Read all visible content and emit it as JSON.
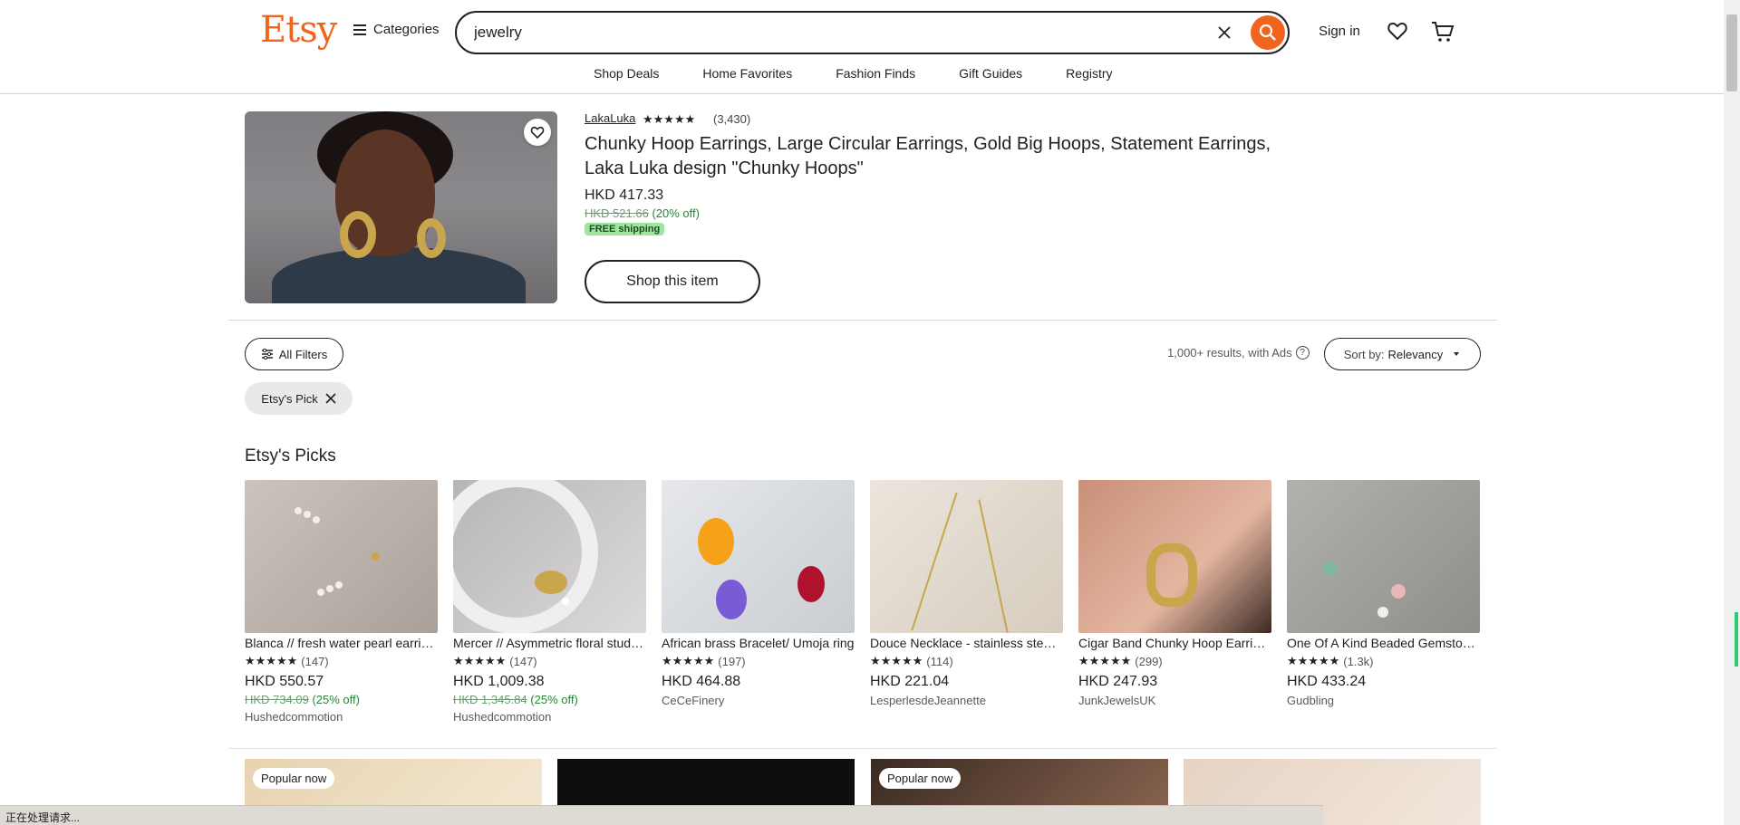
{
  "header": {
    "logo": "Etsy",
    "categories_label": "Categories",
    "search_value": "jewelry",
    "signin_label": "Sign in"
  },
  "subnav": [
    "Shop Deals",
    "Home Favorites",
    "Fashion Finds",
    "Gift Guides",
    "Registry"
  ],
  "featured": {
    "shop": "LakaLuka",
    "stars": "★★★★★",
    "reviews": "(3,430)",
    "title": "Chunky Hoop Earrings, Large Circular Earrings, Gold Big Hoops, Statement Earrings, Laka Luka design \"Chunky Hoops\"",
    "price": "HKD 417.33",
    "original_price": "HKD 521.66",
    "discount": "(20% off)",
    "free_shipping": "FREE shipping",
    "shop_button": "Shop this item"
  },
  "filters": {
    "all_filters": "All Filters",
    "results": "1,000+ results, with Ads",
    "sort_prefix": "Sort by:",
    "sort_value": "Relevancy",
    "active_chip": "Etsy's Pick"
  },
  "picks": {
    "title": "Etsy's Picks",
    "items": [
      {
        "title": "Blanca // fresh water pearl earrings",
        "stars": "★★★★★",
        "reviews": "(147)",
        "price": "HKD 550.57",
        "original": "HKD 734.09",
        "discount": "(25% off)",
        "shop": "Hushedcommotion"
      },
      {
        "title": "Mercer // Asymmetric floral stud earrings",
        "stars": "★★★★★",
        "reviews": "(147)",
        "price": "HKD 1,009.38",
        "original": "HKD 1,345.84",
        "discount": "(25% off)",
        "shop": "Hushedcommotion"
      },
      {
        "title": "African brass Bracelet/ Umoja ring",
        "stars": "★★★★★",
        "reviews": "(197)",
        "price": "HKD 464.88",
        "original": "",
        "discount": "",
        "shop": "CeCeFinery"
      },
      {
        "title": "Douce Necklace - stainless steel chain",
        "stars": "★★★★★",
        "reviews": "(114)",
        "price": "HKD 221.04",
        "original": "",
        "discount": "",
        "shop": "LesperlesdeJeannette"
      },
      {
        "title": "Cigar Band Chunky Hoop Earrings",
        "stars": "★★★★★",
        "reviews": "(299)",
        "price": "HKD 247.93",
        "original": "",
        "discount": "",
        "shop": "JunkJewelsUK"
      },
      {
        "title": "One Of A Kind Beaded Gemstone Necklace",
        "stars": "★★★★★",
        "reviews": "(1.3k)",
        "price": "HKD 433.24",
        "original": "",
        "discount": "",
        "shop": "Gudbling"
      }
    ]
  },
  "bottom": {
    "badge": "Popular now"
  },
  "statusbar": "正在处理请求..."
}
